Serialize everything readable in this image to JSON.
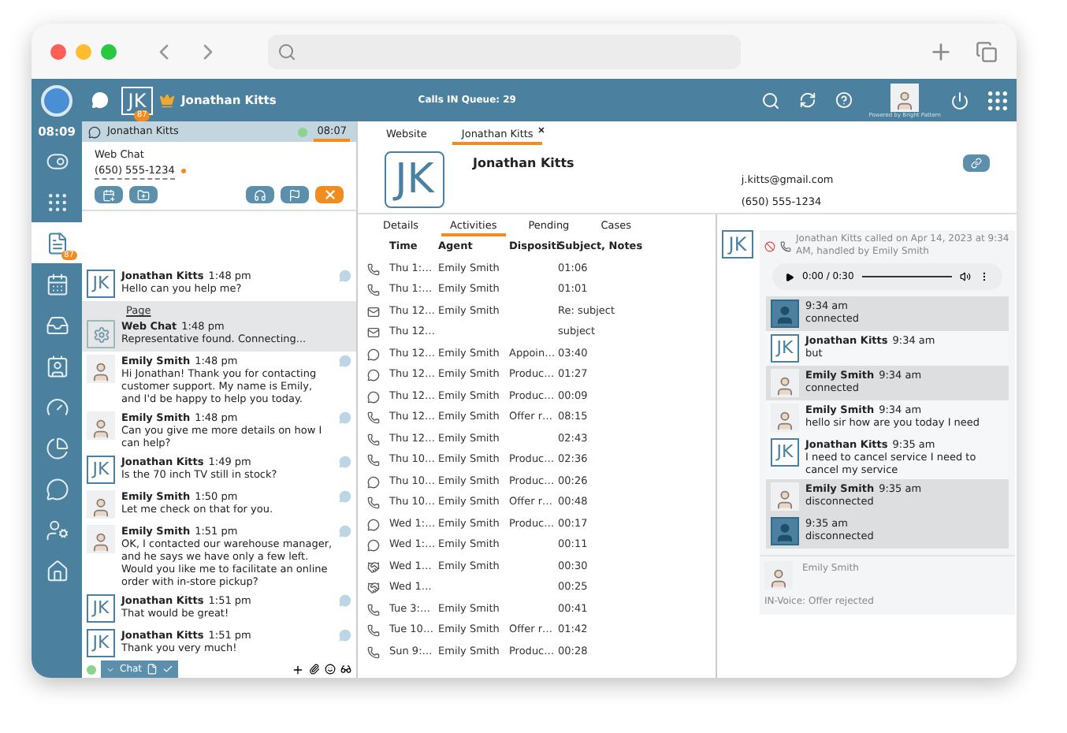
{
  "top_bar": {
    "initials": "JK",
    "badge": "87",
    "contact_name": "Jonathan Kitts",
    "queue": "Calls IN Queue: 29",
    "powered_by": "Powered by Bright Pattern"
  },
  "rail": {
    "time": "08:09",
    "items": [
      {
        "kind": "toggle",
        "selected": false
      },
      {
        "kind": "grid",
        "selected": false
      },
      {
        "kind": "documents",
        "selected": true,
        "badge": "87"
      },
      {
        "kind": "calendar",
        "selected": false
      },
      {
        "kind": "tray",
        "selected": false
      },
      {
        "kind": "contact-card",
        "selected": false
      },
      {
        "kind": "gauge",
        "selected": false
      },
      {
        "kind": "pie",
        "selected": false
      },
      {
        "kind": "chat",
        "selected": false
      },
      {
        "kind": "user-settings",
        "selected": false
      },
      {
        "kind": "home",
        "selected": false
      }
    ]
  },
  "interaction": {
    "name": "Jonathan Kitts",
    "timer": "08:07",
    "channel": "Web Chat",
    "phone": "(650) 555-1234"
  },
  "messages": [
    {
      "kind": "contact",
      "initials": "JK",
      "author": "Jonathan Kitts",
      "time": "1:48 pm",
      "text": "Hello can you help me?"
    },
    {
      "kind": "system",
      "page_label": "Page",
      "author": "Web Chat",
      "time": "1:48 pm",
      "text": "Representative found. Connecting..."
    },
    {
      "kind": "agent",
      "author": "Emily Smith",
      "time": "1:48 pm",
      "text": "Hi Jonathan! Thank you for contacting customer support. My name is Emily, and I'd be happy to help you today."
    },
    {
      "kind": "agent",
      "author": "Emily Smith",
      "time": "1:48 pm",
      "text": "Can you give me more details on how I can help?"
    },
    {
      "kind": "contact",
      "initials": "JK",
      "author": "Jonathan Kitts",
      "time": "1:49 pm",
      "text": "Is the 70 inch TV still in stock?"
    },
    {
      "kind": "agent",
      "author": "Emily Smith",
      "time": "1:50 pm",
      "text": "Let me check on that for you."
    },
    {
      "kind": "agent",
      "author": "Emily Smith",
      "time": "1:51 pm",
      "text": "OK, I contacted our warehouse manager, and he says we have only a few left. Would you like me to facilitate an online order with in-store pickup?"
    },
    {
      "kind": "contact",
      "initials": "JK",
      "author": "Jonathan Kitts",
      "time": "1:51 pm",
      "text": "That would be great!"
    },
    {
      "kind": "contact",
      "initials": "JK",
      "author": "Jonathan Kitts",
      "time": "1:51 pm",
      "text": "Thank you very much!"
    }
  ],
  "composer": {
    "tab": "Chat"
  },
  "tabs": [
    {
      "label": "Website",
      "selected": false
    },
    {
      "label": "Jonathan Kitts",
      "selected": true
    }
  ],
  "contact": {
    "initials": "JK",
    "name": "Jonathan Kitts",
    "email": "j.kitts@gmail.com",
    "phone": "(650) 555-1234"
  },
  "subtabs": [
    {
      "label": "Details",
      "selected": false
    },
    {
      "label": "Activities",
      "selected": true
    },
    {
      "label": "Pending",
      "selected": false
    },
    {
      "label": "Cases",
      "selected": false
    }
  ],
  "table": {
    "columns": [
      "Time",
      "Agent",
      "Dispositi",
      "Subject, Notes"
    ],
    "rows": [
      {
        "kind": "call",
        "time": "Thu 1:…",
        "agent": "Emily Smith",
        "notes": "01:06"
      },
      {
        "kind": "call",
        "time": "Thu 1:…",
        "agent": "Emily Smith",
        "notes": "01:01"
      },
      {
        "kind": "email",
        "time": "Thu 12…",
        "agent": "Emily Smith",
        "notes": "Re: subject"
      },
      {
        "kind": "email",
        "time": "Thu 12…",
        "notes": "subject"
      },
      {
        "kind": "chat",
        "time": "Thu 12…",
        "agent": "Emily Smith",
        "disposition": "Appoin…",
        "notes": "03:40"
      },
      {
        "kind": "chat",
        "time": "Thu 12…",
        "agent": "Emily Smith",
        "disposition": "Produc…",
        "notes": "01:27"
      },
      {
        "kind": "chat",
        "time": "Thu 12…",
        "agent": "Emily Smith",
        "disposition": "Produc…",
        "notes": "00:09"
      },
      {
        "kind": "call",
        "time": "Thu 12…",
        "agent": "Emily Smith",
        "disposition": "Offer r…",
        "notes": "08:15"
      },
      {
        "kind": "call",
        "time": "Thu 12…",
        "agent": "Emily Smith",
        "notes": "02:43"
      },
      {
        "kind": "call",
        "time": "Thu 10…",
        "agent": "Emily Smith",
        "disposition": "Produc…",
        "notes": "02:36"
      },
      {
        "kind": "chat",
        "time": "Thu 10…",
        "agent": "Emily Smith",
        "disposition": "Produc…",
        "notes": "00:26"
      },
      {
        "kind": "call",
        "time": "Thu 10…",
        "agent": "Emily Smith",
        "disposition": "Offer r…",
        "notes": "00:48"
      },
      {
        "kind": "chat",
        "time": "Wed 1:…",
        "agent": "Emily Smith",
        "disposition": "Produc…",
        "notes": "00:17"
      },
      {
        "kind": "chat",
        "time": "Wed 1:…",
        "agent": "Emily Smith",
        "notes": "00:11"
      },
      {
        "kind": "other",
        "time": "Wed 1…",
        "agent": "Emily Smith",
        "notes": "00:30"
      },
      {
        "kind": "other",
        "time": "Wed 1…",
        "notes": "00:25"
      },
      {
        "kind": "call",
        "time": "Tue 3:…",
        "agent": "Emily Smith",
        "notes": "00:41"
      },
      {
        "kind": "call",
        "time": "Tue 10…",
        "agent": "Emily Smith",
        "disposition": "Offer r…",
        "notes": "01:42"
      },
      {
        "kind": "call",
        "time": "Sun 9:…",
        "agent": "Emily Smith",
        "disposition": "Produc…",
        "notes": "00:28"
      }
    ]
  },
  "history": {
    "initials": "JK",
    "summary": "Jonathan Kitts called on Apr 14, 2023 at 9:34 AM, handled by Emily Smith",
    "audio": "0:00 / 0:30",
    "entries": [
      {
        "kind": "system",
        "time": "9:34 am",
        "text": "connected",
        "highlighted": true
      },
      {
        "kind": "contact",
        "initials": "JK",
        "author": "Jonathan Kitts",
        "time": "9:34 am",
        "text": "but",
        "highlighted": false
      },
      {
        "kind": "agent",
        "author": "Emily Smith",
        "time": "9:34 am",
        "text": "connected",
        "highlighted": true
      },
      {
        "kind": "agent",
        "author": "Emily Smith",
        "time": "9:34 am",
        "text": "hello sir how are you today I need",
        "highlighted": false
      },
      {
        "kind": "contact",
        "initials": "JK",
        "author": "Jonathan Kitts",
        "time": "9:35 am",
        "text": "I need to cancel service I need to cancel my service",
        "highlighted": false
      },
      {
        "kind": "agent",
        "author": "Emily Smith",
        "time": "9:35 am",
        "text": "disconnected",
        "highlighted": true
      },
      {
        "kind": "system",
        "time": "9:35 am",
        "text": "disconnected",
        "highlighted": true
      }
    ],
    "footer": {
      "agent": "Emily Smith",
      "note": "IN-Voice: Offer rejected"
    }
  }
}
